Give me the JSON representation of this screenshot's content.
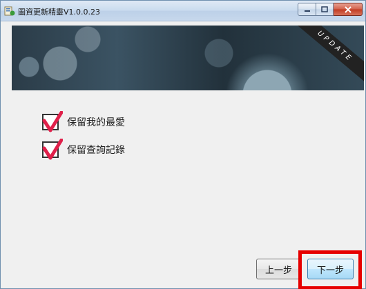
{
  "window": {
    "title": "圖資更新精靈V1.0.0.23"
  },
  "banner": {
    "ribbon_text": "UPDATE"
  },
  "options": [
    {
      "label": "保留我的最愛",
      "checked": true
    },
    {
      "label": "保留查詢記錄",
      "checked": true
    }
  ],
  "buttons": {
    "prev_label": "上一步",
    "next_label": "下一步"
  },
  "colors": {
    "checkmark": "#e0204a",
    "highlight": "#e60000"
  }
}
